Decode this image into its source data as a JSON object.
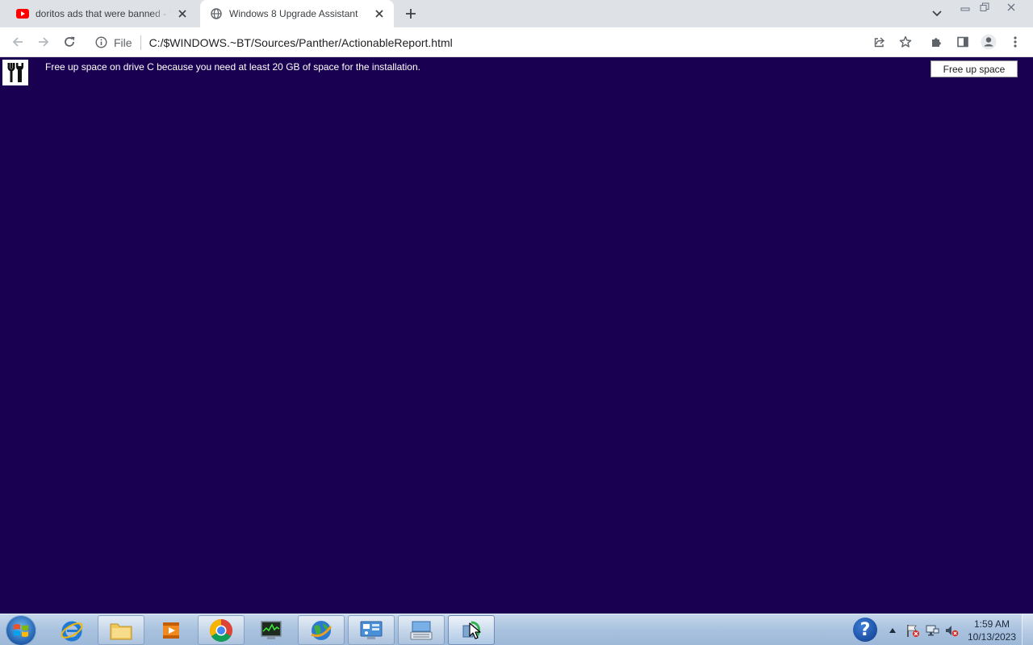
{
  "browser": {
    "tabs": [
      {
        "title": "doritos ads that were banned - YouTube",
        "favicon": "youtube-icon",
        "active": false
      },
      {
        "title": "Windows 8 Upgrade Assistant",
        "favicon": "globe-icon",
        "active": true
      }
    ],
    "address_bar": {
      "site_label": "File",
      "url": "C:/$WINDOWS.~BT/Sources/Panther/ActionableReport.html"
    }
  },
  "page": {
    "message": "Free up space on drive C because you need at least 20 GB of space for the installation.",
    "button_label": "Free up space",
    "background_color": "#1a0050",
    "icon": "tools-icon"
  },
  "taskbar": {
    "pinned": [
      "internet-explorer-icon",
      "file-explorer-icon",
      "media-player-icon",
      "chrome-icon",
      "task-manager-icon",
      "network-globe-icon",
      "control-panel-icon",
      "keyboard-settings-icon",
      "windows-upgrade-icon"
    ],
    "clock": {
      "time": "1:59 AM",
      "date": "10/13/2023"
    }
  }
}
